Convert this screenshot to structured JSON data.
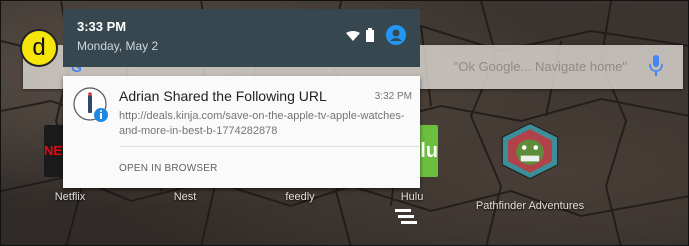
{
  "status": {
    "time": "3:33 PM",
    "date": "Monday, May 2"
  },
  "search": {
    "hint": "\"Ok Google... Navigate home\"",
    "logo": "G"
  },
  "apps": [
    {
      "name": "Netflix",
      "tile_text": "NET",
      "color": "#1a1a1a"
    },
    {
      "name": "Nest",
      "tile_text": "",
      "color": "#6b7a86"
    },
    {
      "name": "feedly",
      "tile_text": "",
      "color": "#5a6e59"
    },
    {
      "name": "Hulu",
      "tile_text": "lulu",
      "color": "#6bbe3e"
    },
    {
      "name": "Pathfinder Adventures",
      "tile_text": "",
      "color": "#b1424a"
    }
  ],
  "notification": {
    "title": "Adrian Shared the Following URL",
    "time": "3:32 PM",
    "body": "http://deals.kinja.com/save-on-the-apple-tv-apple-watches-and-more-in-best-b-1774282878",
    "action": "OPEN IN BROWSER",
    "app_icon": "pushbullet-link-icon"
  },
  "label": "d",
  "colors": {
    "shade": "#37474f",
    "accent": "#2196f3",
    "badge": "#f5e50a"
  }
}
